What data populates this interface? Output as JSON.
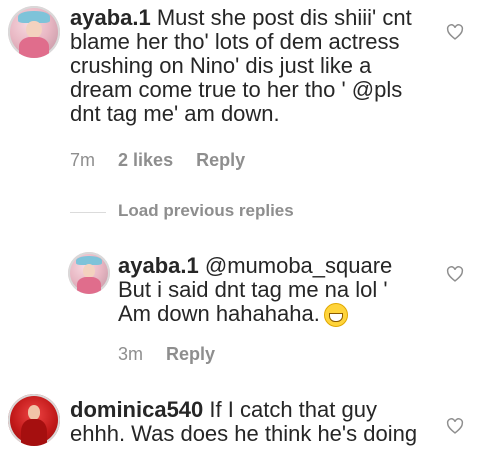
{
  "comments": [
    {
      "username": "ayaba.1",
      "lines": [
        "Must she post dis shiii' cnt",
        "blame her tho' lots of dem actress",
        "crushing on Nino' dis just like a",
        "dream come true to her tho ' @pls",
        "dnt tag me' am down."
      ],
      "time": "7m",
      "likes": "2 likes",
      "reply": "Reply"
    },
    {
      "username": "ayaba.1",
      "lines": [
        "@mumoba_square",
        "But i said dnt tag me na lol '",
        "Am down hahahaha."
      ],
      "time": "3m",
      "reply": "Reply",
      "emoji": "grinning-face-emoji"
    },
    {
      "username": "dominica540",
      "lines": [
        "If I catch that guy",
        "ehhh. Was does he think he's doing"
      ]
    }
  ],
  "load_previous_replies": "Load previous replies",
  "icons": {
    "heart": "heart-outline-icon"
  },
  "colors": {
    "text": "#262626",
    "muted": "#8e8e8e"
  }
}
